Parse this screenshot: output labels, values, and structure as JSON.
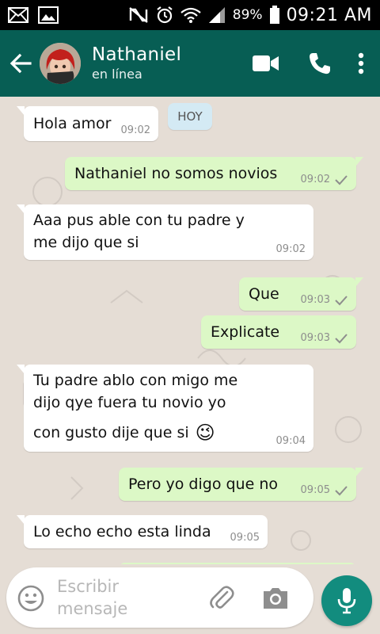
{
  "status_bar": {
    "battery_percent": "89%",
    "time": "09:21 AM",
    "icons": [
      "mail-icon",
      "image-icon",
      "mute-icon",
      "alarm-icon",
      "wifi-icon",
      "signal-icon",
      "battery-icon"
    ]
  },
  "header": {
    "contact_name": "Nathaniel",
    "contact_status": "en línea",
    "icons": [
      "back-arrow-icon",
      "video-call-icon",
      "phone-icon",
      "more-vert-icon"
    ],
    "color": "#075e54"
  },
  "chat": {
    "date_chip": "HOY",
    "messages": [
      {
        "direction": "in",
        "text": "Hola amor",
        "time": "09:02"
      },
      {
        "direction": "out",
        "text": "Nathaniel no somos novios",
        "time": "09:02",
        "status": "sent"
      },
      {
        "direction": "in",
        "lines": [
          "Aaa pus able con tu padre y",
          "me dijo que si"
        ],
        "time": "09:02"
      },
      {
        "direction": "out",
        "text": "Que",
        "time": "09:03",
        "status": "sent"
      },
      {
        "direction": "out",
        "text": "Explicate",
        "time": "09:03",
        "status": "sent"
      },
      {
        "direction": "in",
        "lines": [
          "Tu padre ablo con migo me",
          "dijo qye fuera tu novio yo",
          "con gusto dije que si"
        ],
        "emoji": "😉",
        "time": "09:04"
      },
      {
        "direction": "out",
        "text": "Pero yo digo que no",
        "time": "09:05",
        "status": "sent"
      },
      {
        "direction": "in",
        "text": "Lo echo echo esta linda",
        "time": "09:05"
      }
    ],
    "colors": {
      "incoming": "#ffffff",
      "outgoing": "#dcf8c6",
      "background": "#e5ddd5"
    }
  },
  "composer": {
    "placeholder_line1": "Escribir",
    "placeholder_line2": "mensaje",
    "icons": [
      "emoji-icon",
      "attach-icon",
      "camera-icon",
      "mic-icon"
    ],
    "mic_color": "#128c7e"
  }
}
